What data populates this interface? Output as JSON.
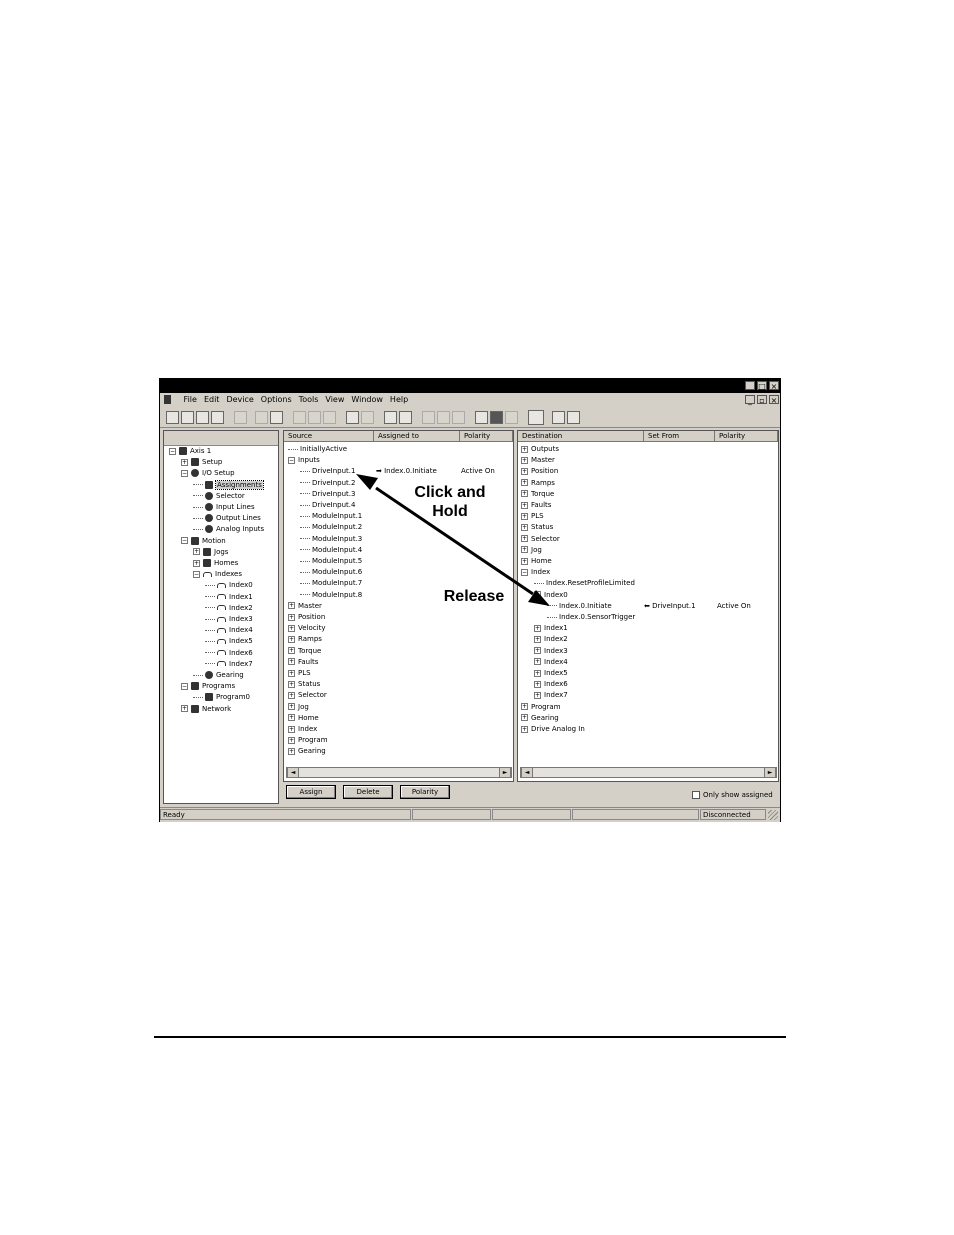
{
  "menu": [
    "File",
    "Edit",
    "Device",
    "Options",
    "Tools",
    "View",
    "Window",
    "Help"
  ],
  "tree": [
    {
      "label": "Axis 1",
      "indent": 0,
      "pm": "−",
      "icon": "device"
    },
    {
      "label": "Setup",
      "indent": 1,
      "pm": "+",
      "icon": "setup"
    },
    {
      "label": "I/O Setup",
      "indent": 1,
      "pm": "−",
      "icon": "io"
    },
    {
      "label": "Assignments",
      "indent": 2,
      "pm": "",
      "icon": "assign",
      "selected": true
    },
    {
      "label": "Selector",
      "indent": 2,
      "pm": "",
      "icon": "selector"
    },
    {
      "label": "Input Lines",
      "indent": 2,
      "pm": "",
      "icon": "io"
    },
    {
      "label": "Output Lines",
      "indent": 2,
      "pm": "",
      "icon": "io"
    },
    {
      "label": "Analog Inputs",
      "indent": 2,
      "pm": "",
      "icon": "io"
    },
    {
      "label": "Motion",
      "indent": 1,
      "pm": "−",
      "icon": "motion"
    },
    {
      "label": "Jogs",
      "indent": 2,
      "pm": "+",
      "icon": "jog"
    },
    {
      "label": "Homes",
      "indent": 2,
      "pm": "+",
      "icon": "home"
    },
    {
      "label": "Indexes",
      "indent": 2,
      "pm": "−",
      "icon": "index"
    },
    {
      "label": "Index0",
      "indent": 3,
      "pm": "",
      "icon": "index"
    },
    {
      "label": "Index1",
      "indent": 3,
      "pm": "",
      "icon": "index"
    },
    {
      "label": "Index2",
      "indent": 3,
      "pm": "",
      "icon": "index"
    },
    {
      "label": "Index3",
      "indent": 3,
      "pm": "",
      "icon": "index"
    },
    {
      "label": "Index4",
      "indent": 3,
      "pm": "",
      "icon": "index"
    },
    {
      "label": "Index5",
      "indent": 3,
      "pm": "",
      "icon": "index"
    },
    {
      "label": "Index6",
      "indent": 3,
      "pm": "",
      "icon": "index"
    },
    {
      "label": "Index7",
      "indent": 3,
      "pm": "",
      "icon": "index"
    },
    {
      "label": "Gearing",
      "indent": 2,
      "pm": "",
      "icon": "gear"
    },
    {
      "label": "Programs",
      "indent": 1,
      "pm": "−",
      "icon": "program"
    },
    {
      "label": "Program0",
      "indent": 2,
      "pm": "",
      "icon": "program"
    },
    {
      "label": "Network",
      "indent": 1,
      "pm": "+",
      "icon": "network"
    }
  ],
  "source": {
    "headers": [
      "Source",
      "Assigned to",
      "Polarity"
    ],
    "rows": [
      {
        "label": "InitiallyActive",
        "indent": 0,
        "pm": ""
      },
      {
        "label": "Inputs",
        "indent": 0,
        "pm": "−"
      },
      {
        "label": "DriveInput.1",
        "indent": 1,
        "pm": "",
        "assigned": "Index.0.Initiate",
        "polarity": "Active On"
      },
      {
        "label": "DriveInput.2",
        "indent": 1,
        "pm": ""
      },
      {
        "label": "DriveInput.3",
        "indent": 1,
        "pm": ""
      },
      {
        "label": "DriveInput.4",
        "indent": 1,
        "pm": ""
      },
      {
        "label": "ModuleInput.1",
        "indent": 1,
        "pm": ""
      },
      {
        "label": "ModuleInput.2",
        "indent": 1,
        "pm": ""
      },
      {
        "label": "ModuleInput.3",
        "indent": 1,
        "pm": ""
      },
      {
        "label": "ModuleInput.4",
        "indent": 1,
        "pm": ""
      },
      {
        "label": "ModuleInput.5",
        "indent": 1,
        "pm": ""
      },
      {
        "label": "ModuleInput.6",
        "indent": 1,
        "pm": ""
      },
      {
        "label": "ModuleInput.7",
        "indent": 1,
        "pm": ""
      },
      {
        "label": "ModuleInput.8",
        "indent": 1,
        "pm": ""
      },
      {
        "label": "Master",
        "indent": 0,
        "pm": "+"
      },
      {
        "label": "Position",
        "indent": 0,
        "pm": "+"
      },
      {
        "label": "Velocity",
        "indent": 0,
        "pm": "+"
      },
      {
        "label": "Ramps",
        "indent": 0,
        "pm": "+"
      },
      {
        "label": "Torque",
        "indent": 0,
        "pm": "+"
      },
      {
        "label": "Faults",
        "indent": 0,
        "pm": "+"
      },
      {
        "label": "PLS",
        "indent": 0,
        "pm": "+"
      },
      {
        "label": "Status",
        "indent": 0,
        "pm": "+"
      },
      {
        "label": "Selector",
        "indent": 0,
        "pm": "+"
      },
      {
        "label": "Jog",
        "indent": 0,
        "pm": "+"
      },
      {
        "label": "Home",
        "indent": 0,
        "pm": "+"
      },
      {
        "label": "Index",
        "indent": 0,
        "pm": "+"
      },
      {
        "label": "Program",
        "indent": 0,
        "pm": "+"
      },
      {
        "label": "Gearing",
        "indent": 0,
        "pm": "+"
      }
    ]
  },
  "destination": {
    "headers": [
      "Destination",
      "Set From",
      "Polarity"
    ],
    "rows": [
      {
        "label": "Outputs",
        "indent": 0,
        "pm": "+"
      },
      {
        "label": "Master",
        "indent": 0,
        "pm": "+"
      },
      {
        "label": "Position",
        "indent": 0,
        "pm": "+"
      },
      {
        "label": "Ramps",
        "indent": 0,
        "pm": "+"
      },
      {
        "label": "Torque",
        "indent": 0,
        "pm": "+"
      },
      {
        "label": "Faults",
        "indent": 0,
        "pm": "+"
      },
      {
        "label": "PLS",
        "indent": 0,
        "pm": "+"
      },
      {
        "label": "Status",
        "indent": 0,
        "pm": "+"
      },
      {
        "label": "Selector",
        "indent": 0,
        "pm": "+"
      },
      {
        "label": "Jog",
        "indent": 0,
        "pm": "+"
      },
      {
        "label": "Home",
        "indent": 0,
        "pm": "+"
      },
      {
        "label": "Index",
        "indent": 0,
        "pm": "−"
      },
      {
        "label": "Index.ResetProfileLimited",
        "indent": 1,
        "pm": ""
      },
      {
        "label": "Index0",
        "indent": 1,
        "pm": "−"
      },
      {
        "label": "Index.0.Initiate",
        "indent": 2,
        "pm": "",
        "setfrom": "DriveInput.1",
        "polarity": "Active On"
      },
      {
        "label": "Index.0.SensorTrigger",
        "indent": 2,
        "pm": ""
      },
      {
        "label": "Index1",
        "indent": 1,
        "pm": "+"
      },
      {
        "label": "Index2",
        "indent": 1,
        "pm": "+"
      },
      {
        "label": "Index3",
        "indent": 1,
        "pm": "+"
      },
      {
        "label": "Index4",
        "indent": 1,
        "pm": "+"
      },
      {
        "label": "Index5",
        "indent": 1,
        "pm": "+"
      },
      {
        "label": "Index6",
        "indent": 1,
        "pm": "+"
      },
      {
        "label": "Index7",
        "indent": 1,
        "pm": "+"
      },
      {
        "label": "Program",
        "indent": 0,
        "pm": "+"
      },
      {
        "label": "Gearing",
        "indent": 0,
        "pm": "+"
      },
      {
        "label": "Drive Analog In",
        "indent": 0,
        "pm": "+"
      }
    ]
  },
  "buttons": {
    "assign": "Assign",
    "delete": "Delete",
    "polarity": "Polarity"
  },
  "only_show_assigned": "Only show assigned",
  "status": {
    "ready": "Ready",
    "connection": "Disconnected"
  },
  "annotations": {
    "click_hold": "Click and\nHold",
    "release": "Release"
  }
}
